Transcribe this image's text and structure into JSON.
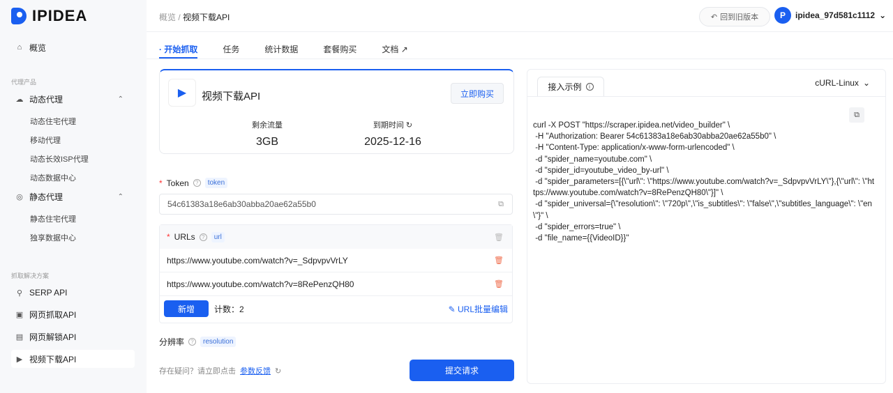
{
  "brand": {
    "name": "IPIDEA",
    "accent": "#1a5ff0"
  },
  "sidebar": {
    "overview": "概览",
    "group1": "代理产品",
    "dynamic": "动态代理",
    "dynamic_items": [
      "动态住宅代理",
      "移动代理",
      "动态长效ISP代理",
      "动态数据中心"
    ],
    "static": "静态代理",
    "static_items": [
      "静态住宅代理",
      "独享数据中心"
    ],
    "group2": "抓取解决方案",
    "solutions": [
      "SERP API",
      "网页抓取API",
      "网页解锁API",
      "视频下载API"
    ]
  },
  "header": {
    "breadcrumb_root": "概览",
    "breadcrumb_sep": "/",
    "breadcrumb_current": "视频下载API",
    "old_version": "回到旧版本",
    "username": "ipidea_97d581c1112"
  },
  "tabs": [
    "开始抓取",
    "任务",
    "统计数据",
    "套餐购买",
    "文档"
  ],
  "product": {
    "name": "视频下载API",
    "buy": "立即购买",
    "remaining_label": "剩余流量",
    "remaining_value": "3GB",
    "expiry_label": "到期时间",
    "expiry_value": "2025-12-16"
  },
  "form": {
    "token_label": "Token",
    "token_tag": "token",
    "token_value": "54c61383a18e6ab30abba20ae62a55b0",
    "urls_label": "URLs",
    "urls_tag": "url",
    "urls": [
      "https://www.youtube.com/watch?v=_SdpvpvVrLY",
      "https://www.youtube.com/watch?v=8RePenzQH80"
    ],
    "add": "新增",
    "count": "计数：2",
    "batch_edit": "URL批量编辑",
    "resolution_label": "分辨率",
    "resolution_tag": "resolution",
    "help": "存在疑问？请立即点击",
    "feedback": "参数反馈",
    "submit": "提交请求"
  },
  "example": {
    "tab": "接入示例",
    "lang": "cURL-Linux",
    "code": "curl -X POST \"https://scraper.ipidea.net/video_builder\" \\\n -H \"Authorization: Bearer 54c61383a18e6ab30abba20ae62a55b0\" \\\n -H \"Content-Type: application/x-www-form-urlencoded\" \\\n -d \"spider_name=youtube.com\" \\\n -d \"spider_id=youtube_video_by-url\" \\\n -d \"spider_parameters=[{\\\"url\\\": \\\"https://www.youtube.com/watch?v=_SdpvpvVrLY\\\"},{\\\"url\\\": \\\"https://www.youtube.com/watch?v=8RePenzQH80\\\"}]\" \\\n -d \"spider_universal={\\\"resolution\\\": \\\"720p\\\",\\\"is_subtitles\\\": \\\"false\\\",\\\"subtitles_language\\\": \\\"en\\\"}\" \\\n -d \"spider_errors=true\" \\\n -d \"file_name={{VideoID}}\""
  }
}
